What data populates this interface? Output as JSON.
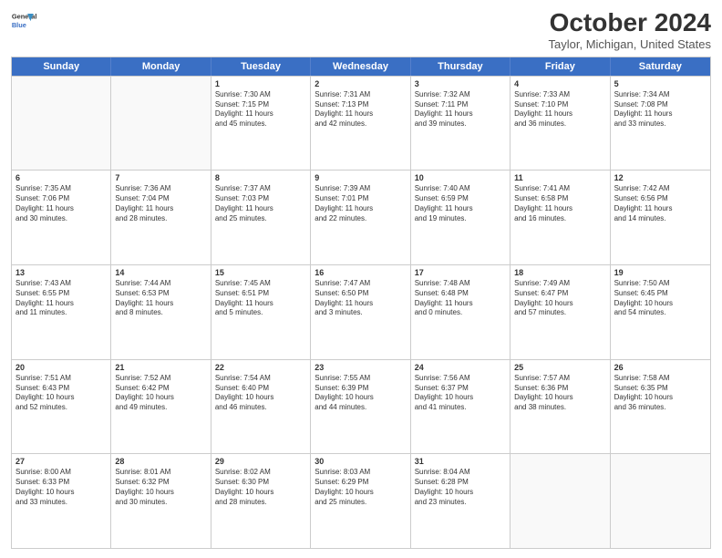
{
  "header": {
    "logo_line1": "General",
    "logo_line2": "Blue",
    "month": "October 2024",
    "location": "Taylor, Michigan, United States"
  },
  "days": [
    "Sunday",
    "Monday",
    "Tuesday",
    "Wednesday",
    "Thursday",
    "Friday",
    "Saturday"
  ],
  "rows": [
    [
      {
        "num": "",
        "empty": true
      },
      {
        "num": "",
        "empty": true
      },
      {
        "num": "1",
        "lines": [
          "Sunrise: 7:30 AM",
          "Sunset: 7:15 PM",
          "Daylight: 11 hours",
          "and 45 minutes."
        ]
      },
      {
        "num": "2",
        "lines": [
          "Sunrise: 7:31 AM",
          "Sunset: 7:13 PM",
          "Daylight: 11 hours",
          "and 42 minutes."
        ]
      },
      {
        "num": "3",
        "lines": [
          "Sunrise: 7:32 AM",
          "Sunset: 7:11 PM",
          "Daylight: 11 hours",
          "and 39 minutes."
        ]
      },
      {
        "num": "4",
        "lines": [
          "Sunrise: 7:33 AM",
          "Sunset: 7:10 PM",
          "Daylight: 11 hours",
          "and 36 minutes."
        ]
      },
      {
        "num": "5",
        "lines": [
          "Sunrise: 7:34 AM",
          "Sunset: 7:08 PM",
          "Daylight: 11 hours",
          "and 33 minutes."
        ]
      }
    ],
    [
      {
        "num": "6",
        "lines": [
          "Sunrise: 7:35 AM",
          "Sunset: 7:06 PM",
          "Daylight: 11 hours",
          "and 30 minutes."
        ]
      },
      {
        "num": "7",
        "lines": [
          "Sunrise: 7:36 AM",
          "Sunset: 7:04 PM",
          "Daylight: 11 hours",
          "and 28 minutes."
        ]
      },
      {
        "num": "8",
        "lines": [
          "Sunrise: 7:37 AM",
          "Sunset: 7:03 PM",
          "Daylight: 11 hours",
          "and 25 minutes."
        ]
      },
      {
        "num": "9",
        "lines": [
          "Sunrise: 7:39 AM",
          "Sunset: 7:01 PM",
          "Daylight: 11 hours",
          "and 22 minutes."
        ]
      },
      {
        "num": "10",
        "lines": [
          "Sunrise: 7:40 AM",
          "Sunset: 6:59 PM",
          "Daylight: 11 hours",
          "and 19 minutes."
        ]
      },
      {
        "num": "11",
        "lines": [
          "Sunrise: 7:41 AM",
          "Sunset: 6:58 PM",
          "Daylight: 11 hours",
          "and 16 minutes."
        ]
      },
      {
        "num": "12",
        "lines": [
          "Sunrise: 7:42 AM",
          "Sunset: 6:56 PM",
          "Daylight: 11 hours",
          "and 14 minutes."
        ]
      }
    ],
    [
      {
        "num": "13",
        "lines": [
          "Sunrise: 7:43 AM",
          "Sunset: 6:55 PM",
          "Daylight: 11 hours",
          "and 11 minutes."
        ]
      },
      {
        "num": "14",
        "lines": [
          "Sunrise: 7:44 AM",
          "Sunset: 6:53 PM",
          "Daylight: 11 hours",
          "and 8 minutes."
        ]
      },
      {
        "num": "15",
        "lines": [
          "Sunrise: 7:45 AM",
          "Sunset: 6:51 PM",
          "Daylight: 11 hours",
          "and 5 minutes."
        ]
      },
      {
        "num": "16",
        "lines": [
          "Sunrise: 7:47 AM",
          "Sunset: 6:50 PM",
          "Daylight: 11 hours",
          "and 3 minutes."
        ]
      },
      {
        "num": "17",
        "lines": [
          "Sunrise: 7:48 AM",
          "Sunset: 6:48 PM",
          "Daylight: 11 hours",
          "and 0 minutes."
        ]
      },
      {
        "num": "18",
        "lines": [
          "Sunrise: 7:49 AM",
          "Sunset: 6:47 PM",
          "Daylight: 10 hours",
          "and 57 minutes."
        ]
      },
      {
        "num": "19",
        "lines": [
          "Sunrise: 7:50 AM",
          "Sunset: 6:45 PM",
          "Daylight: 10 hours",
          "and 54 minutes."
        ]
      }
    ],
    [
      {
        "num": "20",
        "lines": [
          "Sunrise: 7:51 AM",
          "Sunset: 6:43 PM",
          "Daylight: 10 hours",
          "and 52 minutes."
        ]
      },
      {
        "num": "21",
        "lines": [
          "Sunrise: 7:52 AM",
          "Sunset: 6:42 PM",
          "Daylight: 10 hours",
          "and 49 minutes."
        ]
      },
      {
        "num": "22",
        "lines": [
          "Sunrise: 7:54 AM",
          "Sunset: 6:40 PM",
          "Daylight: 10 hours",
          "and 46 minutes."
        ]
      },
      {
        "num": "23",
        "lines": [
          "Sunrise: 7:55 AM",
          "Sunset: 6:39 PM",
          "Daylight: 10 hours",
          "and 44 minutes."
        ]
      },
      {
        "num": "24",
        "lines": [
          "Sunrise: 7:56 AM",
          "Sunset: 6:37 PM",
          "Daylight: 10 hours",
          "and 41 minutes."
        ]
      },
      {
        "num": "25",
        "lines": [
          "Sunrise: 7:57 AM",
          "Sunset: 6:36 PM",
          "Daylight: 10 hours",
          "and 38 minutes."
        ]
      },
      {
        "num": "26",
        "lines": [
          "Sunrise: 7:58 AM",
          "Sunset: 6:35 PM",
          "Daylight: 10 hours",
          "and 36 minutes."
        ]
      }
    ],
    [
      {
        "num": "27",
        "lines": [
          "Sunrise: 8:00 AM",
          "Sunset: 6:33 PM",
          "Daylight: 10 hours",
          "and 33 minutes."
        ]
      },
      {
        "num": "28",
        "lines": [
          "Sunrise: 8:01 AM",
          "Sunset: 6:32 PM",
          "Daylight: 10 hours",
          "and 30 minutes."
        ]
      },
      {
        "num": "29",
        "lines": [
          "Sunrise: 8:02 AM",
          "Sunset: 6:30 PM",
          "Daylight: 10 hours",
          "and 28 minutes."
        ]
      },
      {
        "num": "30",
        "lines": [
          "Sunrise: 8:03 AM",
          "Sunset: 6:29 PM",
          "Daylight: 10 hours",
          "and 25 minutes."
        ]
      },
      {
        "num": "31",
        "lines": [
          "Sunrise: 8:04 AM",
          "Sunset: 6:28 PM",
          "Daylight: 10 hours",
          "and 23 minutes."
        ]
      },
      {
        "num": "",
        "empty": true
      },
      {
        "num": "",
        "empty": true
      }
    ]
  ]
}
